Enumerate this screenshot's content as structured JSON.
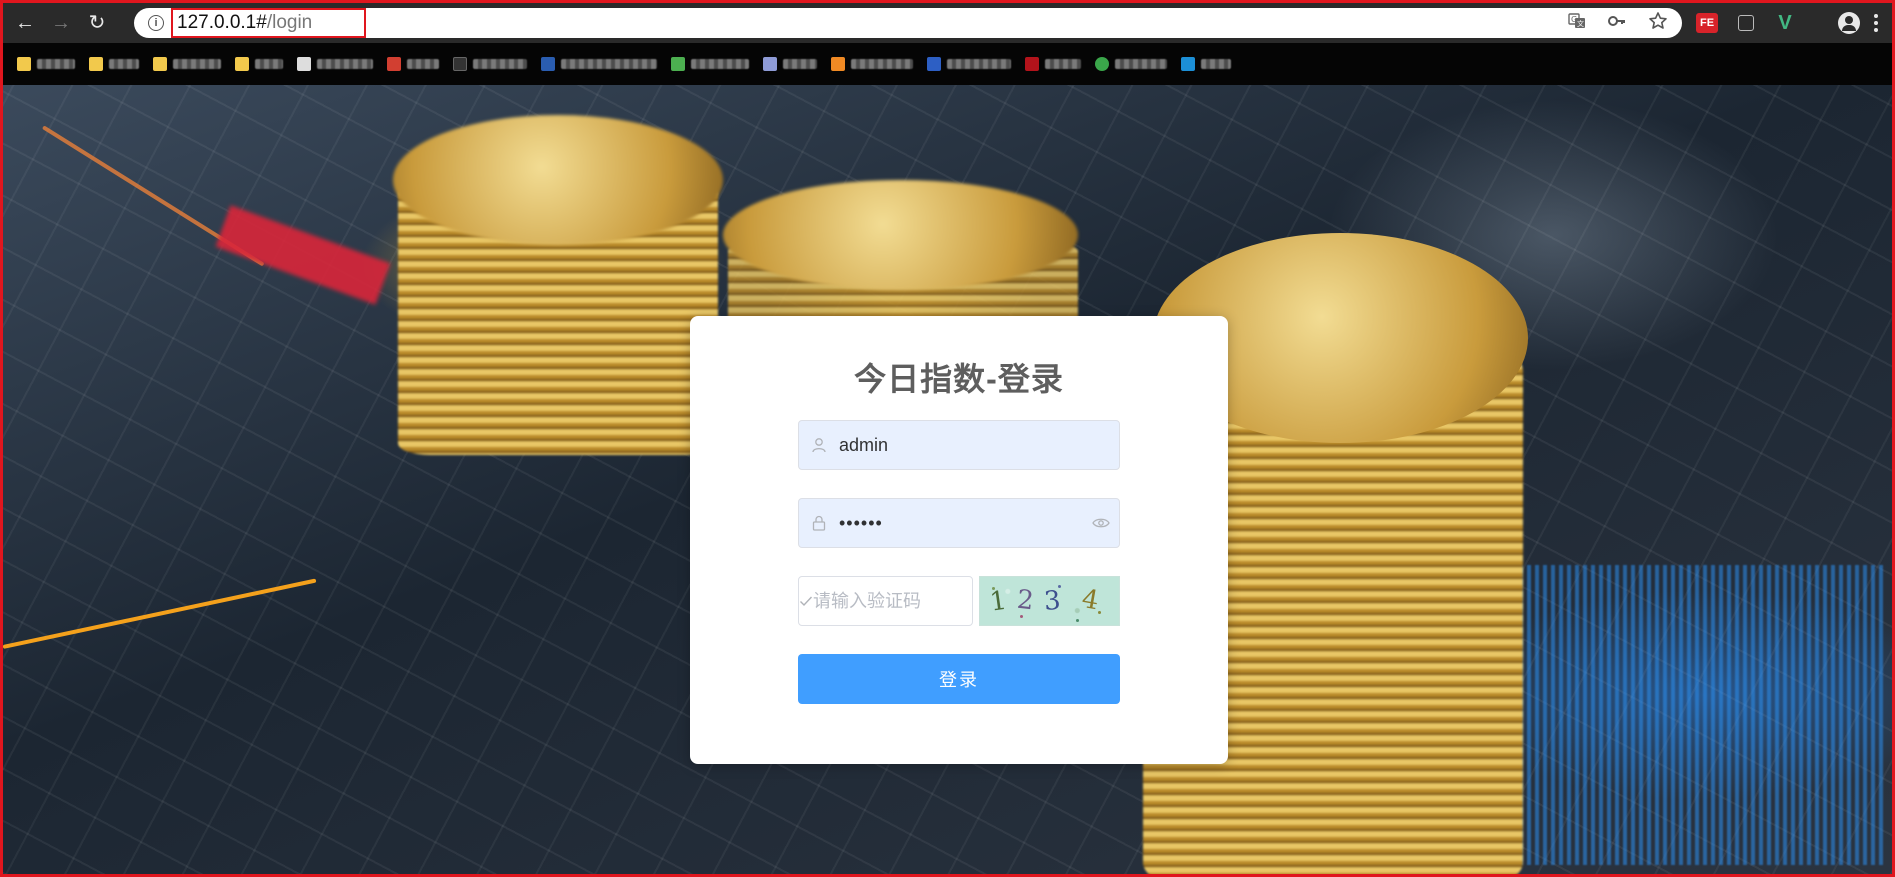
{
  "browser": {
    "url_host": "127.0.0.1#",
    "url_path": "/login",
    "icons": {
      "back": "arrow-left",
      "forward": "arrow-right",
      "reload": "reload",
      "site_info": "info",
      "translate": "translate",
      "password_key": "key",
      "bookmark_star": "star",
      "profile": "account"
    },
    "extensions": [
      {
        "name": "fe-helper",
        "label": "FE",
        "color": "#d8232a"
      },
      {
        "name": "qr-code",
        "label": "",
        "color": "#666666"
      },
      {
        "name": "vue-devtools",
        "label": "V",
        "color": "#42b883"
      }
    ],
    "bookmarks": [
      {
        "icon_color": "#f2c94c"
      },
      {
        "icon_color": "#f2c94c"
      },
      {
        "icon_color": "#f2c94c"
      },
      {
        "icon_color": "#f2c94c"
      },
      {
        "icon_color": "#dddddd"
      },
      {
        "icon_color": "#d23f31"
      },
      {
        "icon_color": "#333333"
      },
      {
        "icon_color": "#2a5db0"
      },
      {
        "icon_color": "#4caf50"
      },
      {
        "icon_color": "#8e9bd6"
      },
      {
        "icon_color": "#f08a24"
      },
      {
        "icon_color": "#2d5fc4"
      },
      {
        "icon_color": "#b3131b"
      },
      {
        "icon_color": "#3aa64a"
      },
      {
        "icon_color": "#1c8fd6"
      }
    ]
  },
  "login": {
    "title": "今日指数-登录",
    "username_value": "admin",
    "password_value": "••••••",
    "captcha_placeholder": "请输入验证码",
    "captcha_text": [
      "1",
      "2",
      "3",
      "4"
    ],
    "submit_label": "登录",
    "colors": {
      "primary": "#409eff",
      "title": "#5e5e5e",
      "autofill_bg": "#e8f0fe"
    }
  }
}
